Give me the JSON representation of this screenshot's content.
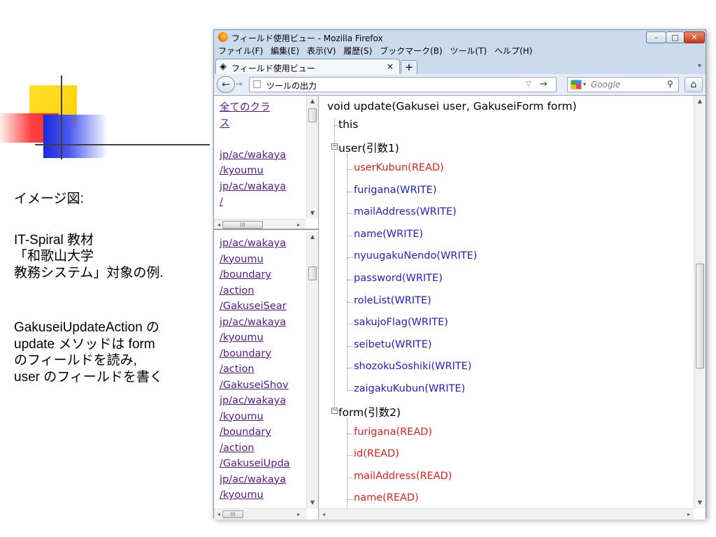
{
  "slide": {
    "caption_label": "イメージ図:",
    "caption_lines": [
      "IT-Spiral 教材",
      "「和歌山大学",
      "教務システム」対象の例."
    ],
    "note_lines": [
      "GakuseiUpdateAction の",
      "update メソッドは form",
      "のフィールドを読み,",
      "user のフィールドを書く"
    ]
  },
  "window": {
    "title": "フィールド使用ビュー - Mozilla Firefox",
    "controls": {
      "minimize": "–",
      "maximize": "□",
      "close": "✕"
    },
    "menu": [
      "ファイル(F)",
      "編集(E)",
      "表示(V)",
      "履歴(S)",
      "ブックマーク(B)",
      "ツール(T)",
      "ヘルプ(H)"
    ],
    "tab": {
      "label": "フィールド使用ビュー",
      "close": "×",
      "new_tab": "+",
      "scroll": "▾"
    },
    "nav": {
      "back": "←",
      "forward": "→",
      "url_text": "ツールの出力",
      "bookmark_star": "▽",
      "go": "→",
      "search_placeholder": "Google",
      "search_drop": "▾",
      "search_icon": "⚲",
      "home": "⌂"
    }
  },
  "left_top_links": [
    "全てのクラ",
    "ス",
    "",
    "jp/ac/wakaya",
    "/kyoumu",
    "jp/ac/wakaya",
    "/"
  ],
  "left_bottom_links": [
    "jp/ac/wakaya",
    "/kyoumu",
    "/boundary",
    "/action",
    "/GakuseiSear",
    "jp/ac/wakaya",
    "/kyoumu",
    "/boundary",
    "/action",
    "/GakuseiShov",
    "jp/ac/wakaya",
    "/kyoumu",
    "/boundary",
    "/action",
    "/GakuseiUpda",
    "jp/ac/wakaya",
    "/kyoumu"
  ],
  "scroll": {
    "h_thumb_label": "III",
    "main_vertical_position": 0.55
  },
  "tree": {
    "method": "void update(Gakusei user, GakuseiForm form)",
    "this": "this",
    "user": {
      "label": "user(引数1)",
      "fields": [
        {
          "name": "userKubun(READ)",
          "kind": "read"
        },
        {
          "name": "furigana(WRITE)",
          "kind": "write"
        },
        {
          "name": "mailAddress(WRITE)",
          "kind": "write"
        },
        {
          "name": "name(WRITE)",
          "kind": "write"
        },
        {
          "name": "nyuugakuNendo(WRITE)",
          "kind": "write"
        },
        {
          "name": "password(WRITE)",
          "kind": "write"
        },
        {
          "name": "roleList(WRITE)",
          "kind": "write"
        },
        {
          "name": "sakujoFlag(WRITE)",
          "kind": "write"
        },
        {
          "name": "seibetu(WRITE)",
          "kind": "write"
        },
        {
          "name": "shozokuSoshiki(WRITE)",
          "kind": "write"
        },
        {
          "name": "zaigakuKubun(WRITE)",
          "kind": "write"
        }
      ]
    },
    "form": {
      "label": "form(引数2)",
      "fields": [
        {
          "name": "furigana(READ)",
          "kind": "read"
        },
        {
          "name": "id(READ)",
          "kind": "read"
        },
        {
          "name": "mailAddress(READ)",
          "kind": "read"
        },
        {
          "name": "name(READ)",
          "kind": "read"
        }
      ]
    },
    "expander_symbol": "−"
  },
  "colors": {
    "read": "#e02020",
    "write": "#2020c8",
    "link": "#551a8b"
  }
}
